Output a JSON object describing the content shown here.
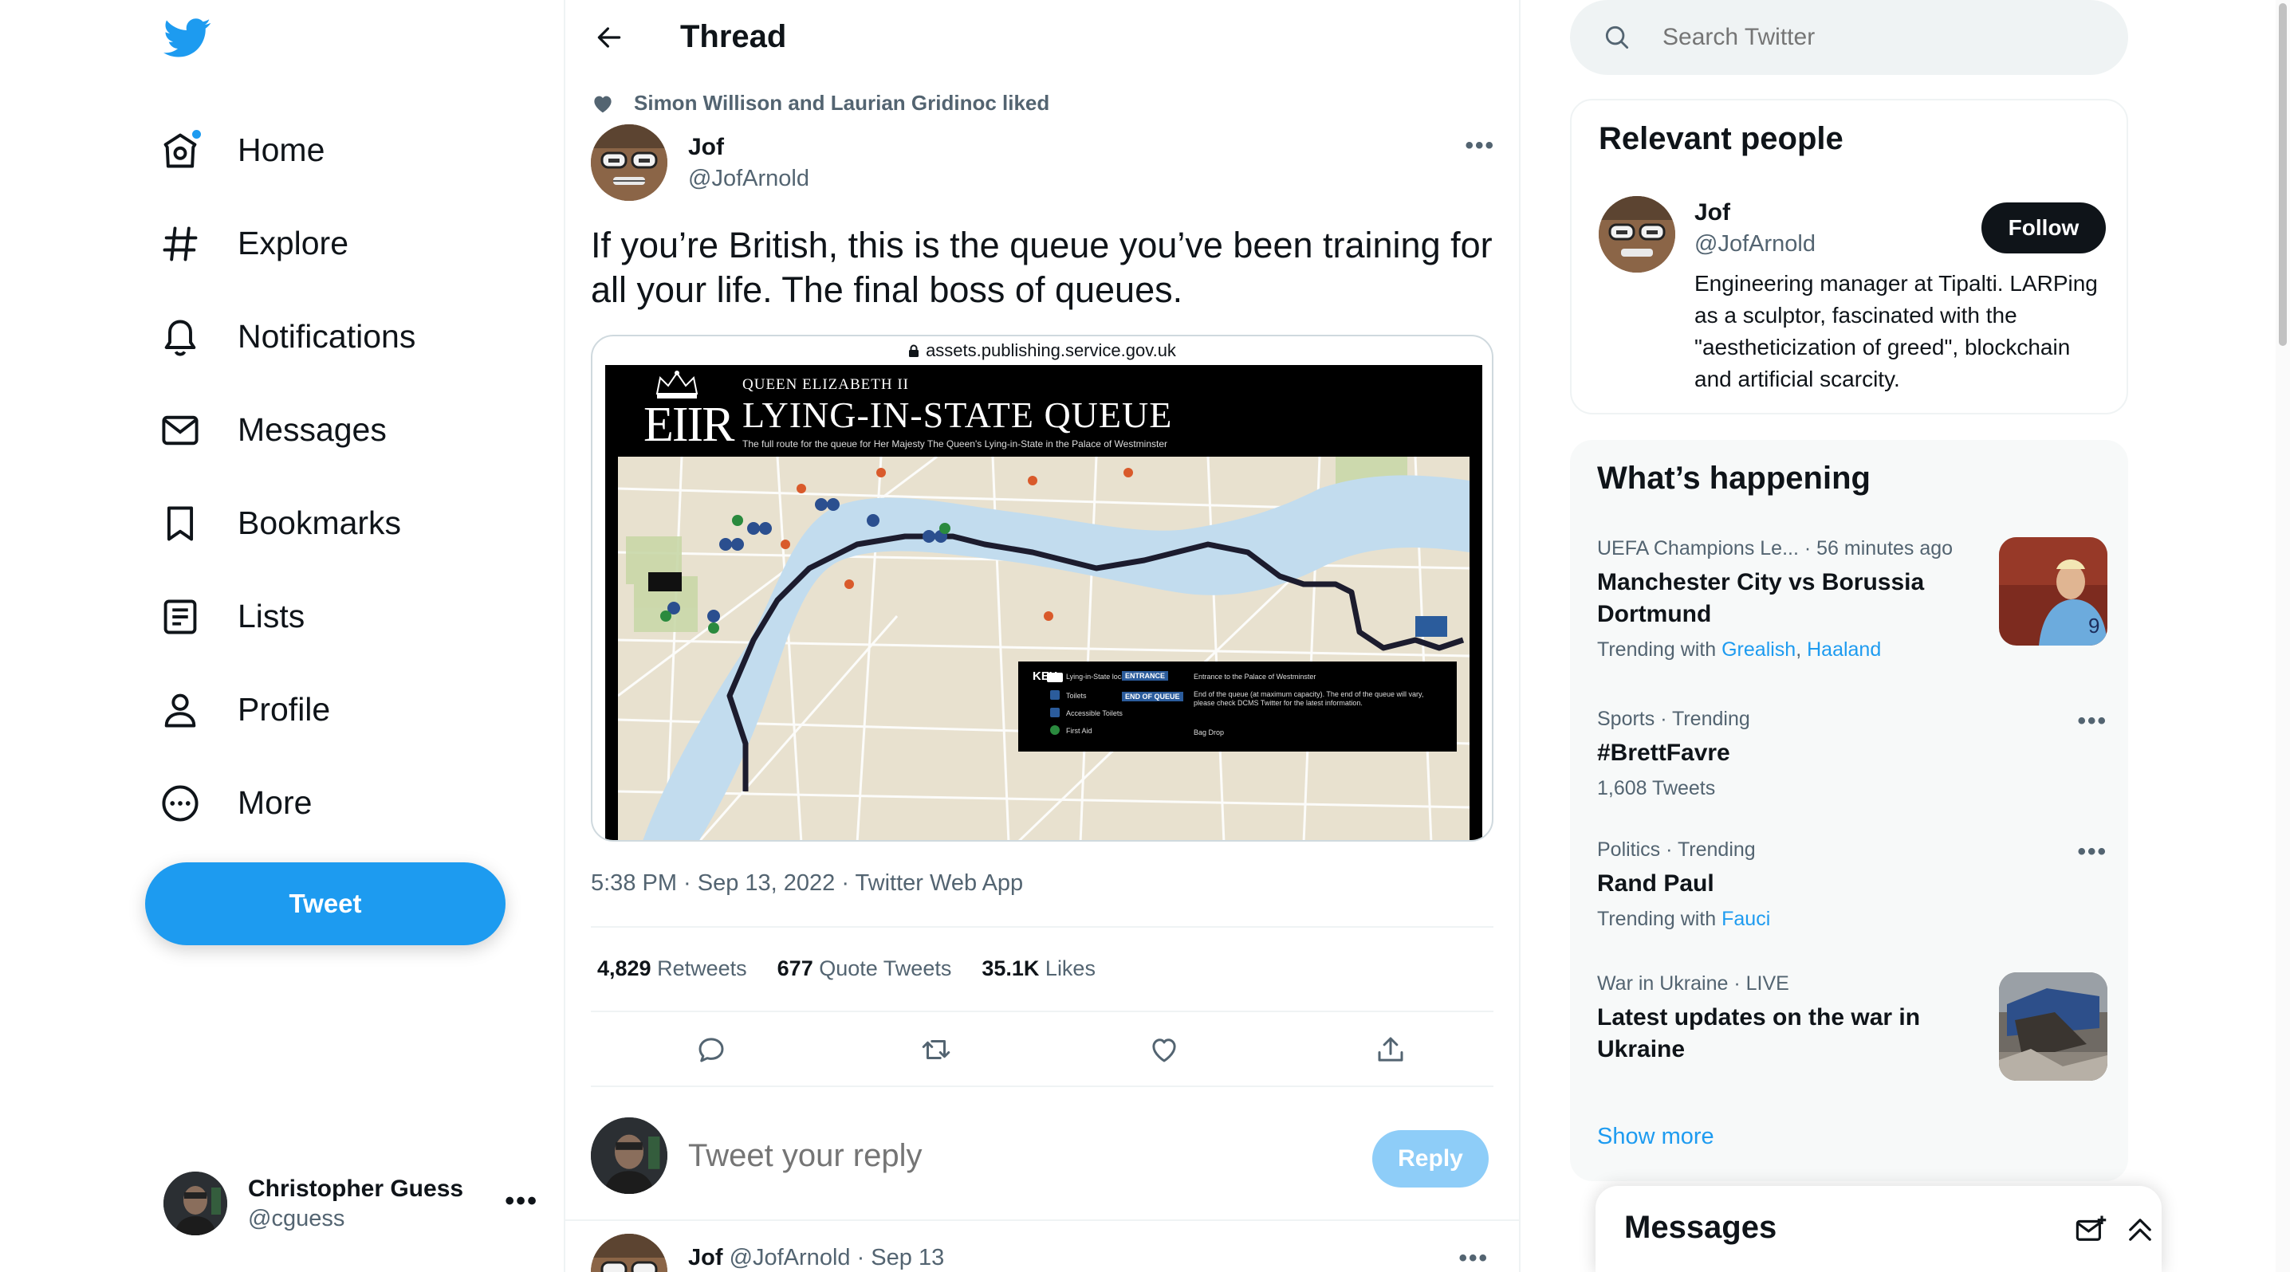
{
  "nav": {
    "items": [
      {
        "label": "Home",
        "icon": "home-icon"
      },
      {
        "label": "Explore",
        "icon": "hashtag-icon"
      },
      {
        "label": "Notifications",
        "icon": "bell-icon"
      },
      {
        "label": "Messages",
        "icon": "envelope-icon"
      },
      {
        "label": "Bookmarks",
        "icon": "bookmark-icon"
      },
      {
        "label": "Lists",
        "icon": "list-icon"
      },
      {
        "label": "Profile",
        "icon": "person-icon"
      },
      {
        "label": "More",
        "icon": "more-circle-icon"
      }
    ],
    "tweet_button": "Tweet",
    "account": {
      "name": "Christopher Guess",
      "handle": "@cguess",
      "more": "•••"
    }
  },
  "thread": {
    "title": "Thread",
    "social_context": "Simon Willison and Laurian Gridinoc liked",
    "author": {
      "name": "Jof",
      "handle": "@JofArnold"
    },
    "more": "•••",
    "text": "If you’re British, this is the queue you’ve been training for all your life. The final boss of queues.",
    "card": {
      "url": "assets.publishing.service.gov.uk",
      "poster": {
        "monogram": "EIIR",
        "subtitle": "QUEEN ELIZABETH II",
        "title": "LYING-IN-STATE QUEUE",
        "description": "The full route for the queue for Her Majesty The Queen's Lying-in-State in the Palace of Westminster",
        "key_title": "KEY",
        "key_items": [
          "Lying-in-State location",
          "Toilets",
          "Accessible Toilets",
          "First Aid",
          "ENTRANCE",
          "Entrance to the Palace of Westminster",
          "END OF QUEUE",
          "End of the queue (at maximum capacity). The end of the queue will vary, please check DCMS Twitter for the latest information.",
          "Bag Drop"
        ]
      }
    },
    "timestamp": "5:38 PM · Sep 13, 2022 · Twitter Web App",
    "stats": {
      "retweets_count": "4,829",
      "retweets_label": "Retweets",
      "quotes_count": "677",
      "quotes_label": "Quote Tweets",
      "likes_count": "35.1K",
      "likes_label": "Likes"
    },
    "reply": {
      "placeholder": "Tweet your reply",
      "button": "Reply"
    },
    "next_tweet": {
      "name": "Jof",
      "handle": "@JofArnold",
      "date": "· Sep 13",
      "more": "•••"
    }
  },
  "right": {
    "search_placeholder": "Search Twitter",
    "relevant": {
      "title": "Relevant people",
      "name": "Jof",
      "handle": "@JofArnold",
      "follow": "Follow",
      "bio": "Engineering manager at Tipalti. LARPing as a sculptor, fascinated with the \"aestheticization of greed\", blockchain and artificial scarcity."
    },
    "happening": {
      "title": "What’s happening",
      "trends": [
        {
          "meta": "UEFA Champions Le...  · 56 minutes ago",
          "title": "Manchester City vs Borussia Dortmund",
          "sub_prefix": "Trending with",
          "links": [
            "Grealish",
            "Haaland"
          ],
          "image": "football-player-photo"
        },
        {
          "meta": "Sports · Trending",
          "title": "#BrettFavre",
          "sub": "1,608 Tweets"
        },
        {
          "meta": "Politics · Trending",
          "title": "Rand Paul",
          "sub_prefix": "Trending with",
          "links": [
            "Fauci"
          ]
        },
        {
          "meta": "War in Ukraine · LIVE",
          "title": "Latest updates on the war in Ukraine",
          "image": "destroyed-building-photo"
        }
      ],
      "show_more": "Show more"
    },
    "messages_drawer": {
      "title": "Messages"
    }
  },
  "colors": {
    "accent": "#1d9bf0",
    "text": "#0f1419",
    "secondary": "#536471",
    "border": "#eff3f4"
  }
}
